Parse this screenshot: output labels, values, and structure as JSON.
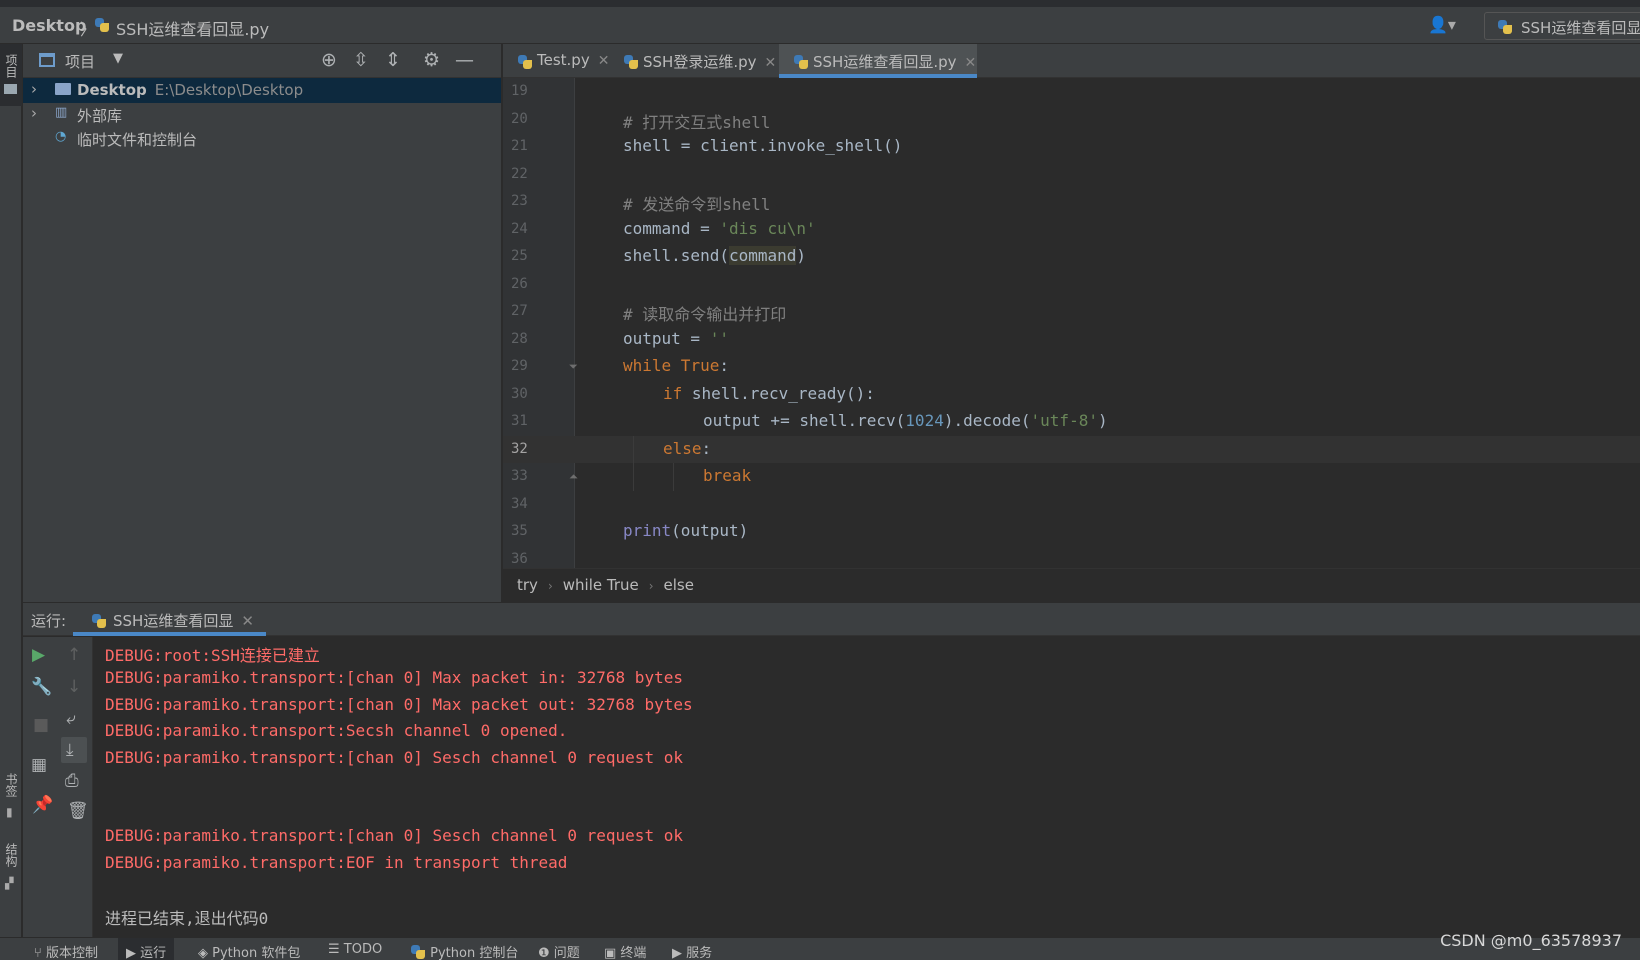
{
  "titlebar": {
    "project": "Desktop",
    "separator": "〉",
    "file": "SSH运维查看回显.py",
    "user_icon": "user-icon",
    "run_config": "SSH运维查看回显"
  },
  "left_strip": {
    "project_tab": "项目",
    "bookmarks_tab": "书签",
    "structure_tab": "结构"
  },
  "project_panel": {
    "title": "项目",
    "tree": [
      {
        "label": "Desktop",
        "path": "E:\\Desktop\\Desktop",
        "expanded": false,
        "icon": "folder-icon"
      },
      {
        "label": "外部库",
        "expanded": false,
        "icon": "library-icon"
      },
      {
        "label": "临时文件和控制台",
        "icon": "scratches-icon"
      }
    ]
  },
  "editor": {
    "tabs": [
      {
        "label": "Test.py",
        "active": false
      },
      {
        "label": "SSH登录运维.py",
        "active": false
      },
      {
        "label": "SSH运维查看回显.py",
        "active": true
      }
    ],
    "current_line": 32,
    "lines": [
      {
        "n": "19"
      },
      {
        "n": "20",
        "comment": "# 打开交互式shell"
      },
      {
        "n": "21",
        "text": "shell = client.invoke_shell()"
      },
      {
        "n": "22"
      },
      {
        "n": "23",
        "comment": "# 发送命令到shell"
      },
      {
        "n": "24",
        "a": "command = ",
        "s": "'dis cu\\n'"
      },
      {
        "n": "25",
        "a": "shell.send(",
        "h": "command",
        "b": ")"
      },
      {
        "n": "26"
      },
      {
        "n": "27",
        "comment": "# 读取命令输出并打印"
      },
      {
        "n": "28",
        "a": "output = ",
        "s": "''"
      },
      {
        "n": "29",
        "k": "while",
        "k2": "True",
        "b": ":"
      },
      {
        "n": "30",
        "k": "if",
        "a": " shell.recv_ready():"
      },
      {
        "n": "31",
        "a": "output += shell.recv(",
        "num": "1024",
        "b": ").decode(",
        "s": "'utf-8'",
        "c": ")"
      },
      {
        "n": "32",
        "k": "else",
        "b": ":"
      },
      {
        "n": "33",
        "k": "break"
      },
      {
        "n": "34"
      },
      {
        "n": "35",
        "bi": "print",
        "a": "(output)"
      },
      {
        "n": "36"
      }
    ],
    "breadcrumb": [
      "try",
      "while True",
      "else"
    ]
  },
  "run_panel": {
    "label": "运行:",
    "tab": "SSH运维查看回显",
    "console": [
      "DEBUG:root:SSH连接已建立",
      "DEBUG:paramiko.transport:[chan 0] Max packet in: 32768 bytes",
      "DEBUG:paramiko.transport:[chan 0] Max packet out: 32768 bytes",
      "DEBUG:paramiko.transport:Secsh channel 0 opened.",
      "DEBUG:paramiko.transport:[chan 0] Sesch channel 0 request ok",
      "DEBUG:paramiko.transport:[chan 0] Sesch channel 0 request ok",
      "DEBUG:paramiko.transport:EOF in transport thread"
    ],
    "exit_message": "进程已结束,退出代码0"
  },
  "bottombar": {
    "items": [
      "版本控制",
      "运行",
      "Python 软件包",
      "TODO",
      "Python 控制台",
      "问题",
      "终端",
      "服务"
    ]
  },
  "watermark": "CSDN @m0_63578937",
  "colors": {
    "keyword": "#cc7832",
    "string": "#6a8759",
    "comment": "#808080",
    "number": "#6897bb",
    "console_error": "#ff6b68",
    "accent": "#4a88c7"
  }
}
